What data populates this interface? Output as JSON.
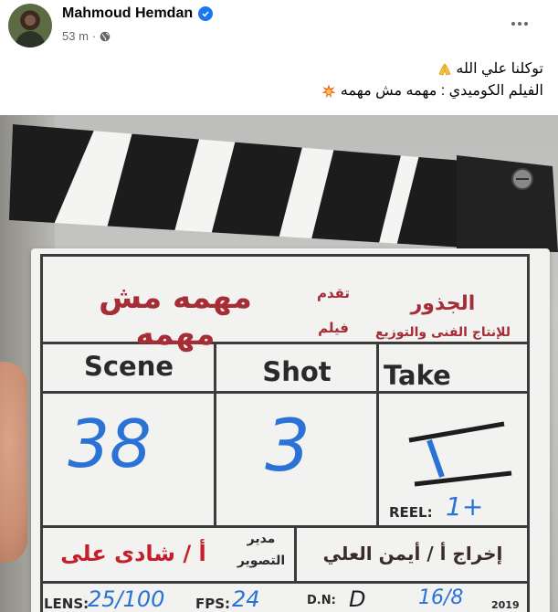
{
  "post": {
    "author": "Mahmoud Hemdan",
    "time": "53 m",
    "line1": "توكلنا علي الله",
    "line2": "الفيلم الكوميدي : مهمه مش مهمه"
  },
  "clapper": {
    "film_title": "مهمه مش مهمه",
    "presents_top": "تقدم",
    "presents_bottom": "فيلم",
    "company_top": "الجذور",
    "company_bottom": "للإنتاج الفنى والتوزيع",
    "scene_label": "Scene",
    "shot_label": "Shot",
    "take_label": "Take",
    "scene_value": "38",
    "shot_value": "3",
    "take_value": "1",
    "reel_label": "REEL:",
    "reel_value": "1+",
    "dop_title_top": "مدير",
    "dop_title_bottom": "التصوير",
    "dop_name": "أ / شادى على",
    "director": "إخراج أ / أيمن العلي",
    "lens_label": "LENS:",
    "lens_value": "25/100",
    "fps_label": "FPS:",
    "fps_value": "24",
    "dn_label": "D.N:",
    "dn_value": "D",
    "date_value": "16/8",
    "year_value": "2019"
  }
}
